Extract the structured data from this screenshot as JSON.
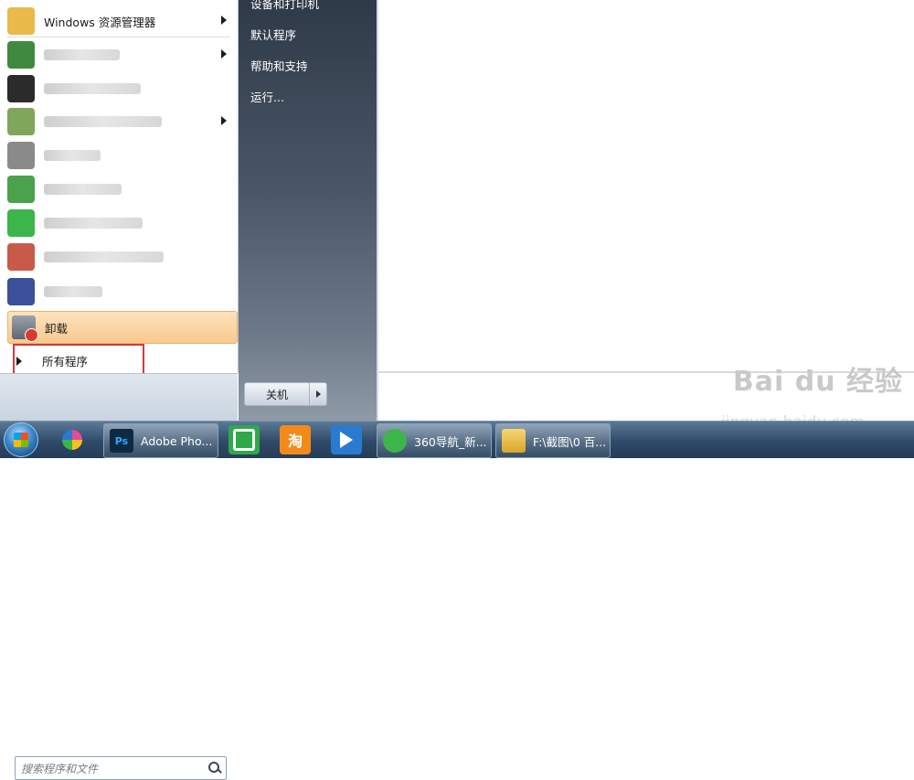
{
  "start_menu": {
    "programs": [
      {
        "label": "Windows 资源管理器",
        "icon": "folder-explorer-icon",
        "color": "#e9b94a",
        "has_submenu": true,
        "blurred": false
      },
      {
        "label": "",
        "icon": "app-icon",
        "color": "#3f8a3f",
        "has_submenu": true,
        "blurred": true
      },
      {
        "label": "",
        "icon": "qq-icon",
        "color": "#2b2b2b",
        "has_submenu": false,
        "blurred": true
      },
      {
        "label": "",
        "icon": "app-icon",
        "color": "#7fa65a",
        "has_submenu": true,
        "blurred": true
      },
      {
        "label": "",
        "icon": "app-icon",
        "color": "#8a8a8a",
        "has_submenu": false,
        "blurred": true
      },
      {
        "label": "",
        "icon": "browser-icon",
        "color": "#4aa24a",
        "has_submenu": false,
        "blurred": true
      },
      {
        "label": "",
        "icon": "wechat-icon",
        "color": "#3cb54a",
        "has_submenu": false,
        "blurred": true
      },
      {
        "label": "",
        "icon": "app-icon",
        "color": "#c95a4a",
        "has_submenu": false,
        "blurred": true
      },
      {
        "label": "",
        "icon": "shield-icon",
        "color": "#3b4f9a",
        "has_submenu": false,
        "blurred": true
      }
    ],
    "uninstall_label": "卸载",
    "all_programs_label": "所有程序",
    "search_placeholder": "搜索程序和文件",
    "right_links": [
      "设备和打印机",
      "默认程序",
      "帮助和支持",
      "运行..."
    ],
    "shutdown_label": "关机"
  },
  "taskbar": {
    "pinned": [
      {
        "name": "pinwheel-icon",
        "color": "#e84a9a"
      },
      {
        "name": "green-app-icon",
        "color": "#2fa84a"
      },
      {
        "name": "taobao-icon",
        "label": "淘",
        "color": "#f28a1a"
      },
      {
        "name": "xunlei-icon",
        "color": "#2a7bd0"
      }
    ],
    "photoshop_label": "Adobe Pho...",
    "photoshop_icon_text": "Ps",
    "browser_label": "360导航_新...",
    "folder_label": "F:\\截图\\0 百..."
  },
  "watermark": {
    "brand": "Bai du 经验",
    "url": "jingyan.baidu.com"
  }
}
